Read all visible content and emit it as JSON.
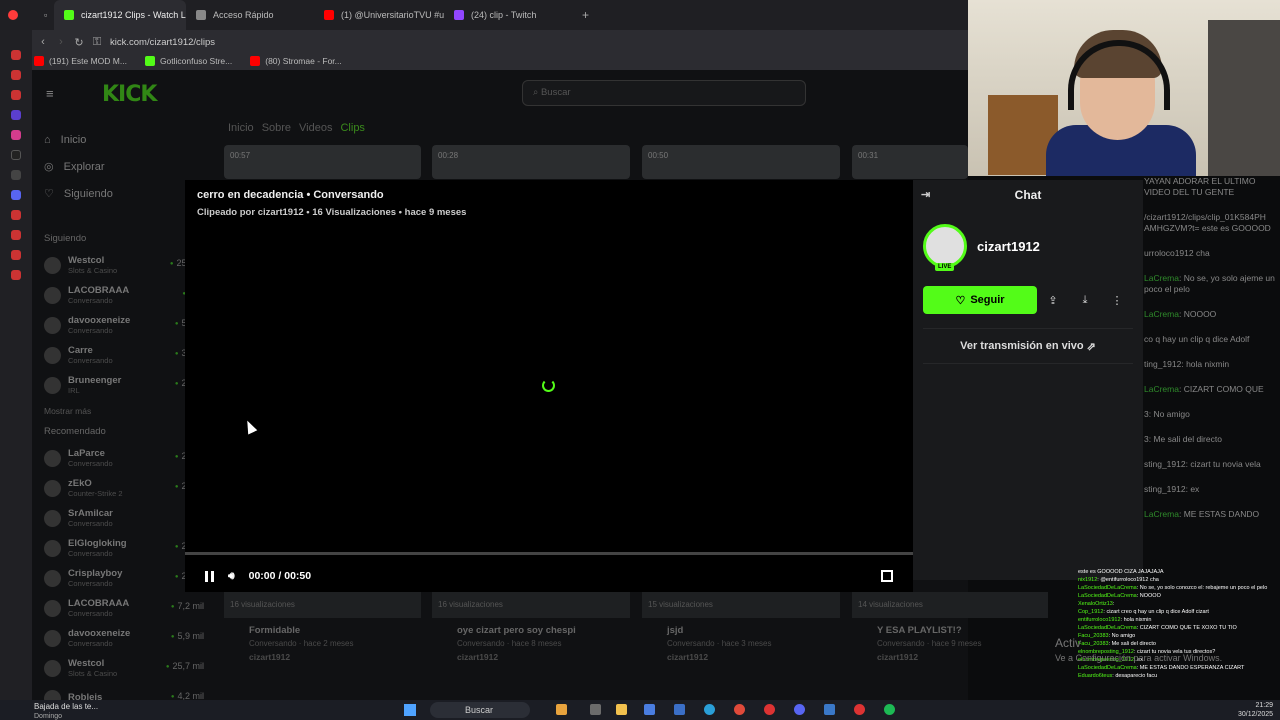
{
  "browser": {
    "tabs": [
      {
        "label": "cizart1912 Clips - Watch L",
        "active": true,
        "color": "#53fc18"
      },
      {
        "label": "Acceso Rápido",
        "active": false,
        "color": "#888888"
      },
      {
        "label": "(1) @UniversitarioTVU #u",
        "active": false,
        "color": "#ff0000"
      },
      {
        "label": "(24) clip - Twitch",
        "active": false,
        "color": "#9146ff"
      }
    ],
    "url": "kick.com/cizart1912/clips",
    "bookmarks": [
      {
        "label": "(191) Este MOD M...",
        "color": "#ff0000"
      },
      {
        "label": "Gotliconfuso Stre...",
        "color": "#53fc18"
      },
      {
        "label": "(80) Stromae - For...",
        "color": "#ff0000"
      }
    ]
  },
  "kick": {
    "logo": "KICK",
    "search_placeholder": "Buscar",
    "nav": [
      {
        "label": "Inicio",
        "icon": "home-icon"
      },
      {
        "label": "Explorar",
        "icon": "compass-icon"
      },
      {
        "label": "Siguiendo",
        "icon": "heart-icon"
      }
    ],
    "following_label": "Siguiendo",
    "following": [
      {
        "name": "Westcol",
        "game": "Slots & Casino",
        "viewers": "25,2 m"
      },
      {
        "name": "LACOBRAAA",
        "game": "Conversando",
        "viewers": "7 m"
      },
      {
        "name": "davooxeneize",
        "game": "Conversando",
        "viewers": "5,8 m"
      },
      {
        "name": "Carre",
        "game": "Conversando",
        "viewers": "3,3 m"
      },
      {
        "name": "Bruneenger",
        "game": "IRL",
        "viewers": "2,9 m"
      }
    ],
    "show_more": "Mostrar más",
    "recommended_label": "Recomendado",
    "recommended": [
      {
        "name": "LaParce",
        "game": "Conversando",
        "viewers": "2,8 m"
      },
      {
        "name": "zEkO",
        "game": "Counter-Strike 2",
        "viewers": "2,4 m"
      },
      {
        "name": "SrAmilcar",
        "game": "Conversando",
        "viewers": "38"
      },
      {
        "name": "ElGlogloking",
        "game": "Conversando",
        "viewers": "2,8 m"
      },
      {
        "name": "Crisplayboy",
        "game": "Conversando",
        "viewers": "2,9 m"
      },
      {
        "name": "LACOBRAAA",
        "game": "Conversando",
        "viewers": "7,2 mil"
      },
      {
        "name": "davooxeneize",
        "game": "Conversando",
        "viewers": "5,9 mil"
      },
      {
        "name": "Westcol",
        "game": "Slots & Casino",
        "viewers": "25,7 mil"
      },
      {
        "name": "Robleis",
        "game": "",
        "viewers": "4,2 mil"
      }
    ],
    "subtabs": [
      "Inicio",
      "Sobre",
      "Videos",
      "Clips"
    ],
    "thumb_times": [
      "00:57",
      "00:28",
      "00:50",
      "00:31"
    ],
    "cards": [
      {
        "views": "16 visualizaciones",
        "title": "Formidable",
        "meta": "Conversando · hace 2 meses",
        "owner": "cizart1912"
      },
      {
        "views": "16 visualizaciones",
        "title": "oye cizart pero soy chespi",
        "meta": "Conversando · hace 8 meses",
        "owner": "cizart1912"
      },
      {
        "views": "15 visualizaciones",
        "title": "jsjd",
        "meta": "Conversando · hace 3 meses",
        "owner": "cizart1912"
      },
      {
        "views": "14 visualizaciones",
        "title": "Y ESA PLAYLIST!?",
        "meta": "Conversando · hace 9 meses",
        "owner": "cizart1912"
      }
    ]
  },
  "modal": {
    "title": "cerro en decadencia • Conversando",
    "subtitle": "Clipeado por cizart1912 • 16 Visualizaciones • hace 9 meses",
    "time": "00:00 / 00:50",
    "progress": 0,
    "chat_header": "Chat",
    "channel": "cizart1912",
    "live_badge": "LIVE",
    "follow": "Seguir",
    "watch_live": "Ver transmisión en vivo"
  },
  "overlay_chat": [
    {
      "user": "",
      "text": "YAYAN ADORAR EL ULTIMO VIDEO DEL TU GENTE"
    },
    {
      "user": "",
      "text": "/cizart1912/clips/clip_01K584PH AMHGZVM?t= este es GOOOOD"
    },
    {
      "user": "",
      "text": "urroloco1912 cha"
    },
    {
      "user": "LaCrema",
      "text": "No se, yo solo ajeme un poco el pelo"
    },
    {
      "user": "LaCrema",
      "text": "NOOOO"
    },
    {
      "user": "",
      "text": "co q hay un clip q dice Adolf"
    },
    {
      "user": "",
      "text": "ting_1912: hola nixmin"
    },
    {
      "user": "LaCrema",
      "text": "CIZART COMO QUE"
    },
    {
      "user": "",
      "text": "3: No amigo"
    },
    {
      "user": "",
      "text": "3: Me sali del directo"
    },
    {
      "user": "",
      "text": "sting_1912: cizart tu novia vela"
    },
    {
      "user": "",
      "text": "sting_1912: ex"
    },
    {
      "user": "LaCrema",
      "text": "ME ESTAS DANDO"
    }
  ],
  "small_chat": [
    {
      "user": "",
      "text": "este es GOOOOD CIZA JAJAJAJA"
    },
    {
      "user": "nix1912",
      "text": "@entifurroloco1912 cha"
    },
    {
      "user": "LaSociedadDeLaCrema",
      "text": "No se, yo solo conozco el: rebajeme un poco el pelo"
    },
    {
      "user": "LaSociedadDeLaCrema",
      "text": "NOOOO"
    },
    {
      "user": "XenaloOrtiz13",
      "text": ""
    },
    {
      "user": "Cop_1912",
      "text": "cizart creo q hay un clip q dice Adolf cizart"
    },
    {
      "user": "entifurroloco1912",
      "text": "hola nixmin"
    },
    {
      "user": "LaSociedadDeLaCrema",
      "text": "CIZART COMO QUE TE XOXO TU TIO"
    },
    {
      "user": "Facu_20383",
      "text": "No amigo"
    },
    {
      "user": "Facu_20383",
      "text": "Me sali del directo"
    },
    {
      "user": "elnombreposting_1912",
      "text": "cizart tu novia vela tus directos?"
    },
    {
      "user": "elnombreposting_1912",
      "text": "ex"
    },
    {
      "user": "LaSociedadDeLaCrema",
      "text": "ME ESTAS DANDO ESPERANZA CIZART"
    },
    {
      "user": "Eduardo6teus",
      "text": "desaparecio facu"
    }
  ],
  "windows": {
    "activate": "Activ",
    "activate2": "Ve a Configuración para activar Windows.",
    "taskbar_left": "Bajada de las te...",
    "taskbar_left_sub": "Domingo",
    "taskbar_search": "Buscar",
    "clock": "21:29",
    "date": "30/12/2025"
  }
}
